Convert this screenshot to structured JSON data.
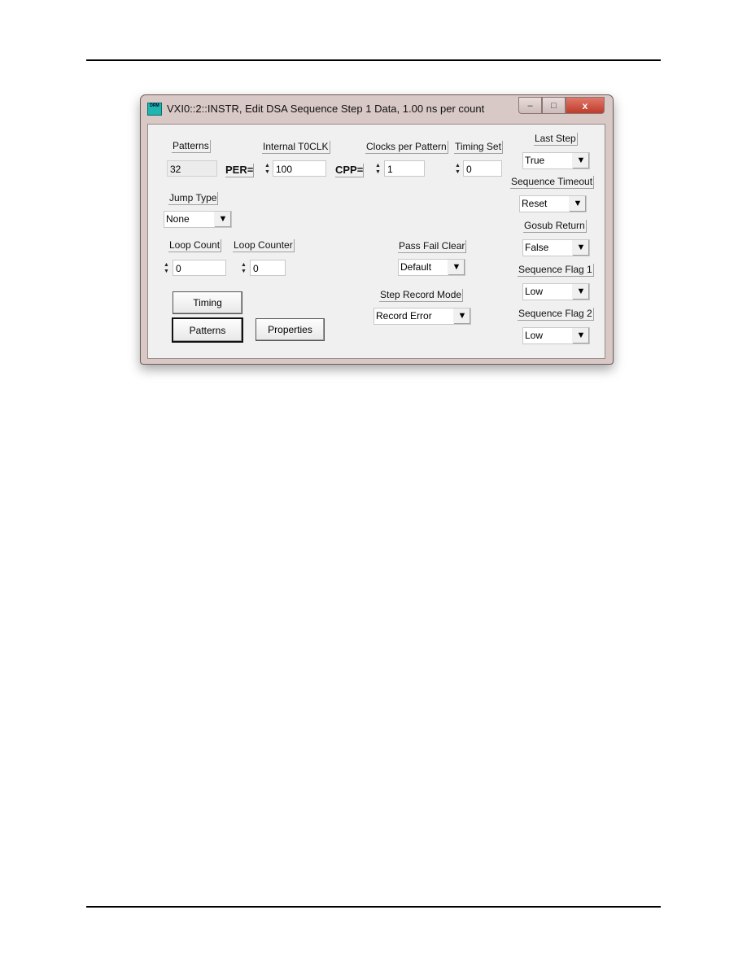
{
  "window": {
    "title": "VXI0::2::INSTR, Edit DSA Sequence Step 1 Data, 1.00 ns per count",
    "app_icon_text": "DRM",
    "controls": {
      "minimize": "–",
      "maximize": "□",
      "close": "x"
    }
  },
  "fields": {
    "patterns": {
      "label": "Patterns",
      "value": "32"
    },
    "per_label": "PER=",
    "internal_t0clk": {
      "label": "Internal T0CLK",
      "value": "100"
    },
    "cpp_label": "CPP=",
    "clocks_per_pattern": {
      "label": "Clocks per Pattern",
      "value": "1"
    },
    "timing_set": {
      "label": "Timing Set",
      "value": "0"
    },
    "jump_type": {
      "label": "Jump Type",
      "value": "None"
    },
    "loop_count": {
      "label": "Loop Count",
      "value": "0"
    },
    "loop_counter": {
      "label": "Loop Counter",
      "value": "0"
    },
    "pass_fail_clear": {
      "label": "Pass Fail Clear",
      "value": "Default"
    },
    "step_record_mode": {
      "label": "Step Record Mode",
      "value": "Record Error"
    },
    "last_step": {
      "label": "Last Step",
      "value": "True"
    },
    "sequence_timeout": {
      "label": "Sequence Timeout",
      "value": "Reset"
    },
    "gosub_return": {
      "label": "Gosub Return",
      "value": "False"
    },
    "sequence_flag_1": {
      "label": "Sequence Flag 1",
      "value": "Low"
    },
    "sequence_flag_2": {
      "label": "Sequence Flag 2",
      "value": "Low"
    }
  },
  "buttons": {
    "timing": "Timing",
    "patterns": "Patterns",
    "properties": "Properties"
  },
  "icons": {
    "spin_up": "▲",
    "spin_down": "▼",
    "dropdown": "▼"
  }
}
